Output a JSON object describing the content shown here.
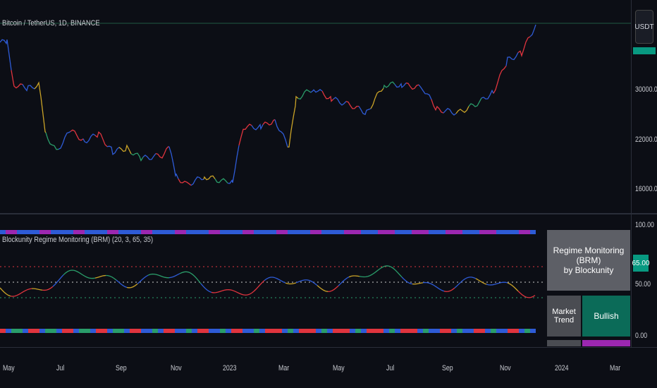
{
  "symbol_title": "Bitcoin / TetherUS, 1D, BINANCE",
  "currency_button": "USDT",
  "price_axis": [
    "30000.00",
    "22000.00",
    "16000.00"
  ],
  "indicator": {
    "title": "Blockunity Regime Monitoring (BRM) (20, 3, 65, 35)",
    "axis": [
      "100.00",
      "50.00",
      "0.00"
    ],
    "current_value": "65.00",
    "table": {
      "header": "Regime Monitoring (BRM)\nby Blockunity",
      "label": "Market Trend",
      "value": "Bullish"
    }
  },
  "time_axis": [
    "May",
    "Jul",
    "Sep",
    "Nov",
    "2023",
    "Mar",
    "May",
    "Jul",
    "Sep",
    "Nov",
    "2024",
    "Mar"
  ],
  "colors": {
    "bg": "#0c0e15",
    "bullish": "#089981",
    "accent_purple": "#9c27b0",
    "blue": "#2e5bd6",
    "red": "#e0343e",
    "yellow": "#c9a227",
    "green": "#2a9d6a"
  }
}
